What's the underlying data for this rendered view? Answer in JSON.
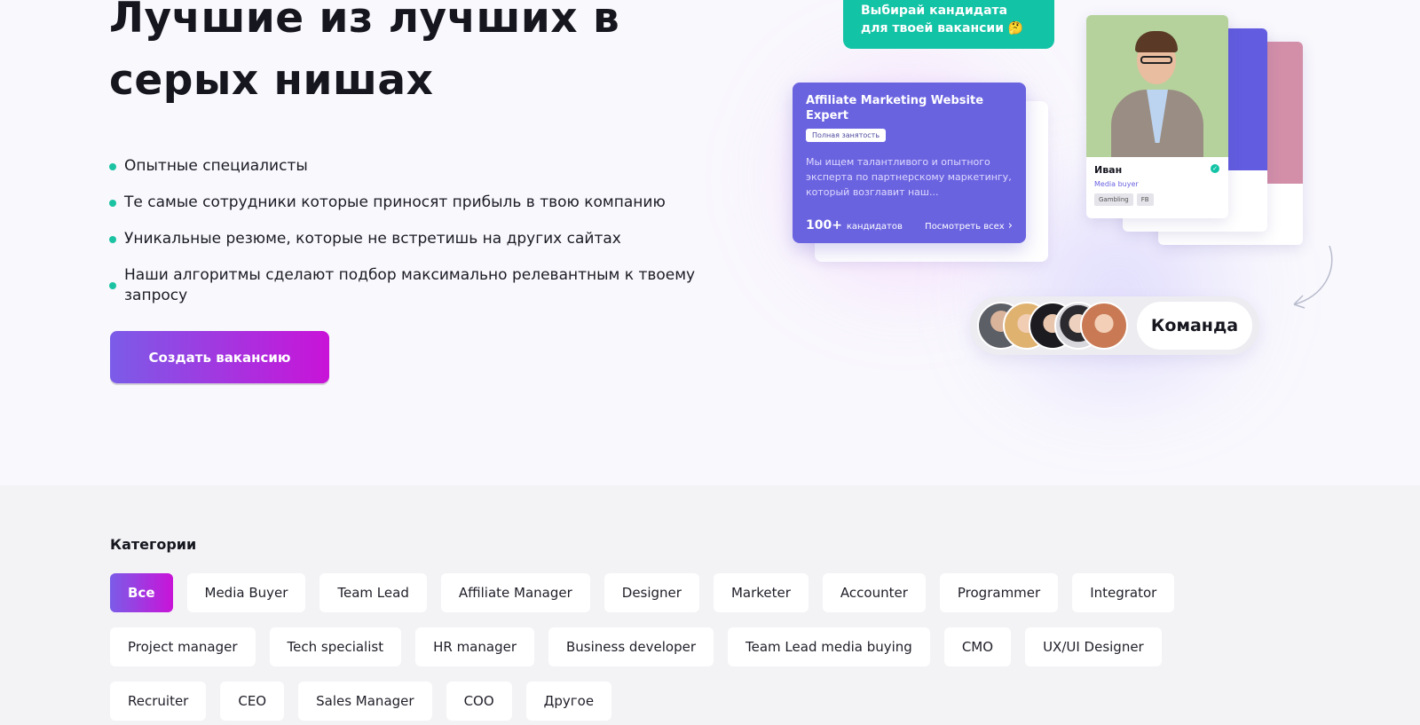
{
  "hero": {
    "title_line1": "Лучшие из лучших в",
    "title_line2": "серых нишах",
    "features": [
      "Опытные специалисты",
      "Те самые сотрудники которые приносят прибыль в твою компанию",
      "Уникальные резюме, которые не встретишь на других сайтах",
      "Наши алгоритмы сделают подбор максимально релевантным к твоему запросу"
    ],
    "cta_label": "Создать вакансию"
  },
  "illustration": {
    "tooltip": "Выбирай кандидата для твоей вакансии 🤔",
    "job": {
      "title": "Affiliate Marketing Website Expert",
      "tag": "Полная занятость",
      "description": "Мы ищем талантливого и опытного эксперта по партнерскому маркетингу, который возглавит наш...",
      "count": "100+",
      "count_suffix": "кандидатов",
      "link": "Посмотреть всех"
    },
    "candidate": {
      "name": "Иван",
      "role": "Media buyer",
      "chips": [
        "Gambling",
        "FB"
      ]
    },
    "team_label": "Команда"
  },
  "categories": {
    "title": "Категории",
    "row1": [
      "Все",
      "Media Buyer",
      "Team Lead",
      "Affiliate Manager",
      "Designer",
      "Marketer",
      "Accounter",
      "Programmer",
      "Integrator"
    ],
    "row2": [
      "Project manager",
      "Tech specialist",
      "HR manager",
      "Business developer",
      "Team Lead media buying",
      "CMO",
      "UX/UI Designer"
    ],
    "row3": [
      "Recruiter",
      "CEO",
      "Sales Manager",
      "COO",
      "Другое"
    ],
    "active": "Все"
  },
  "colors": {
    "accent_gradient_start": "#7b5ce8",
    "accent_gradient_end": "#c913d8",
    "teal": "#13c3a6",
    "job_card": "#6a63e0"
  }
}
